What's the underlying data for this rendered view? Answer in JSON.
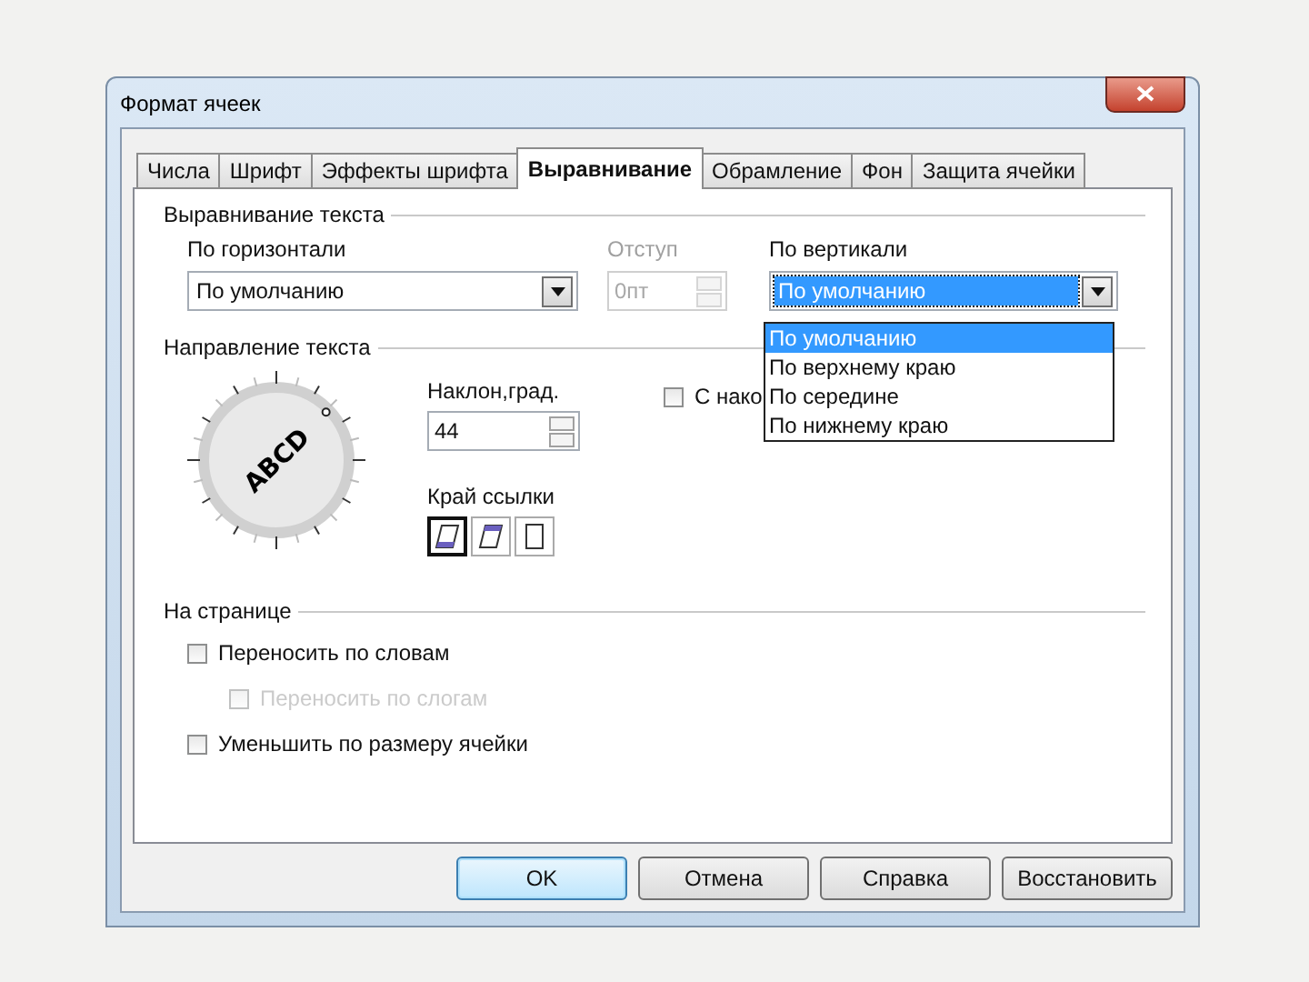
{
  "window": {
    "title": "Формат ячеек"
  },
  "tabs": [
    {
      "label": "Числа",
      "selected": false
    },
    {
      "label": "Шрифт",
      "selected": false
    },
    {
      "label": "Эффекты шрифта",
      "selected": false
    },
    {
      "label": "Выравнивание",
      "selected": true
    },
    {
      "label": "Обрамление",
      "selected": false
    },
    {
      "label": "Фон",
      "selected": false
    },
    {
      "label": "Защита ячейки",
      "selected": false
    }
  ],
  "alignment": {
    "heading": "Выравнивание текста",
    "horizontal": {
      "label": "По горизонтали",
      "value": "По умолчанию"
    },
    "indent": {
      "label": "Отступ",
      "value": "0пт",
      "disabled": true
    },
    "vertical": {
      "label": "По вертикали",
      "value": "По умолчанию",
      "expanded": true,
      "options": [
        {
          "label": "По умолчанию",
          "selected": true
        },
        {
          "label": "По верхнему краю",
          "selected": false
        },
        {
          "label": "По середине",
          "selected": false
        },
        {
          "label": "По нижнему краю",
          "selected": false
        }
      ]
    }
  },
  "direction": {
    "heading": "Направление текста",
    "dial_text": "ABCD",
    "angle": {
      "label": "Наклон,град.",
      "value": "44"
    },
    "stacked": {
      "label": "С нако",
      "checked": false
    },
    "reference_edge": {
      "label": "Край ссылки",
      "options": [
        {
          "kind": "bottom",
          "selected": true
        },
        {
          "kind": "top",
          "selected": false
        },
        {
          "kind": "none",
          "selected": false
        }
      ]
    }
  },
  "page": {
    "heading": "На странице",
    "options": [
      {
        "label": "Переносить по словам",
        "checked": false,
        "disabled": false,
        "children": [
          {
            "label": "Переносить по слогам",
            "checked": false,
            "disabled": true
          }
        ]
      },
      {
        "label": "Уменьшить по размеру ячейки",
        "checked": false,
        "disabled": false
      }
    ]
  },
  "buttons": [
    {
      "label": "OK",
      "default": true
    },
    {
      "label": "Отмена",
      "default": false
    },
    {
      "label": "Справка",
      "default": false
    },
    {
      "label": "Восстановить",
      "default": false
    }
  ]
}
